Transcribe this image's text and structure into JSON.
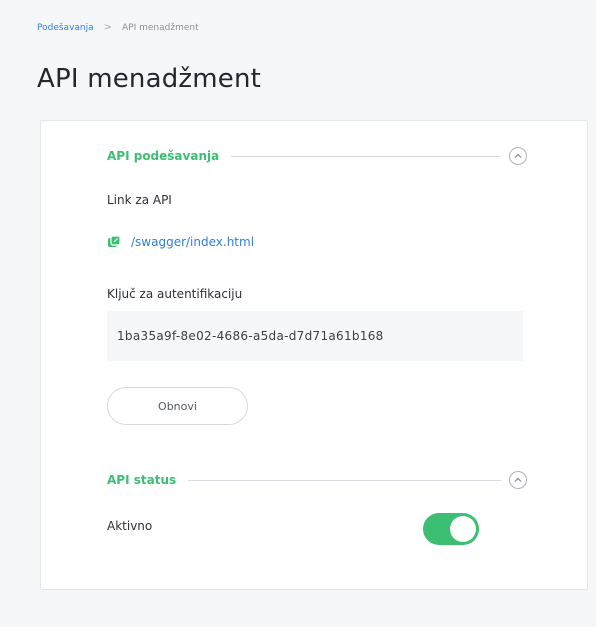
{
  "breadcrumb": {
    "parent": "Podešavanja",
    "separator": ">",
    "current": "API menadžment"
  },
  "page": {
    "title": "API menadžment"
  },
  "api_settings": {
    "section_title": "API podešavanja",
    "link_label": "Link za API",
    "link_icon": "external-link-icon",
    "link_text": "/swagger/index.html",
    "key_label": "Ključ za autentifikaciju",
    "key_value": "1ba35a9f-8e02-4686-a5da-d7d71a61b168",
    "refresh_label": "Obnovi"
  },
  "api_status": {
    "section_title": "API status",
    "status_label": "Aktivno",
    "enabled": true
  },
  "colors": {
    "accent_green": "#3cbf73",
    "link_blue": "#2f7fd6"
  }
}
